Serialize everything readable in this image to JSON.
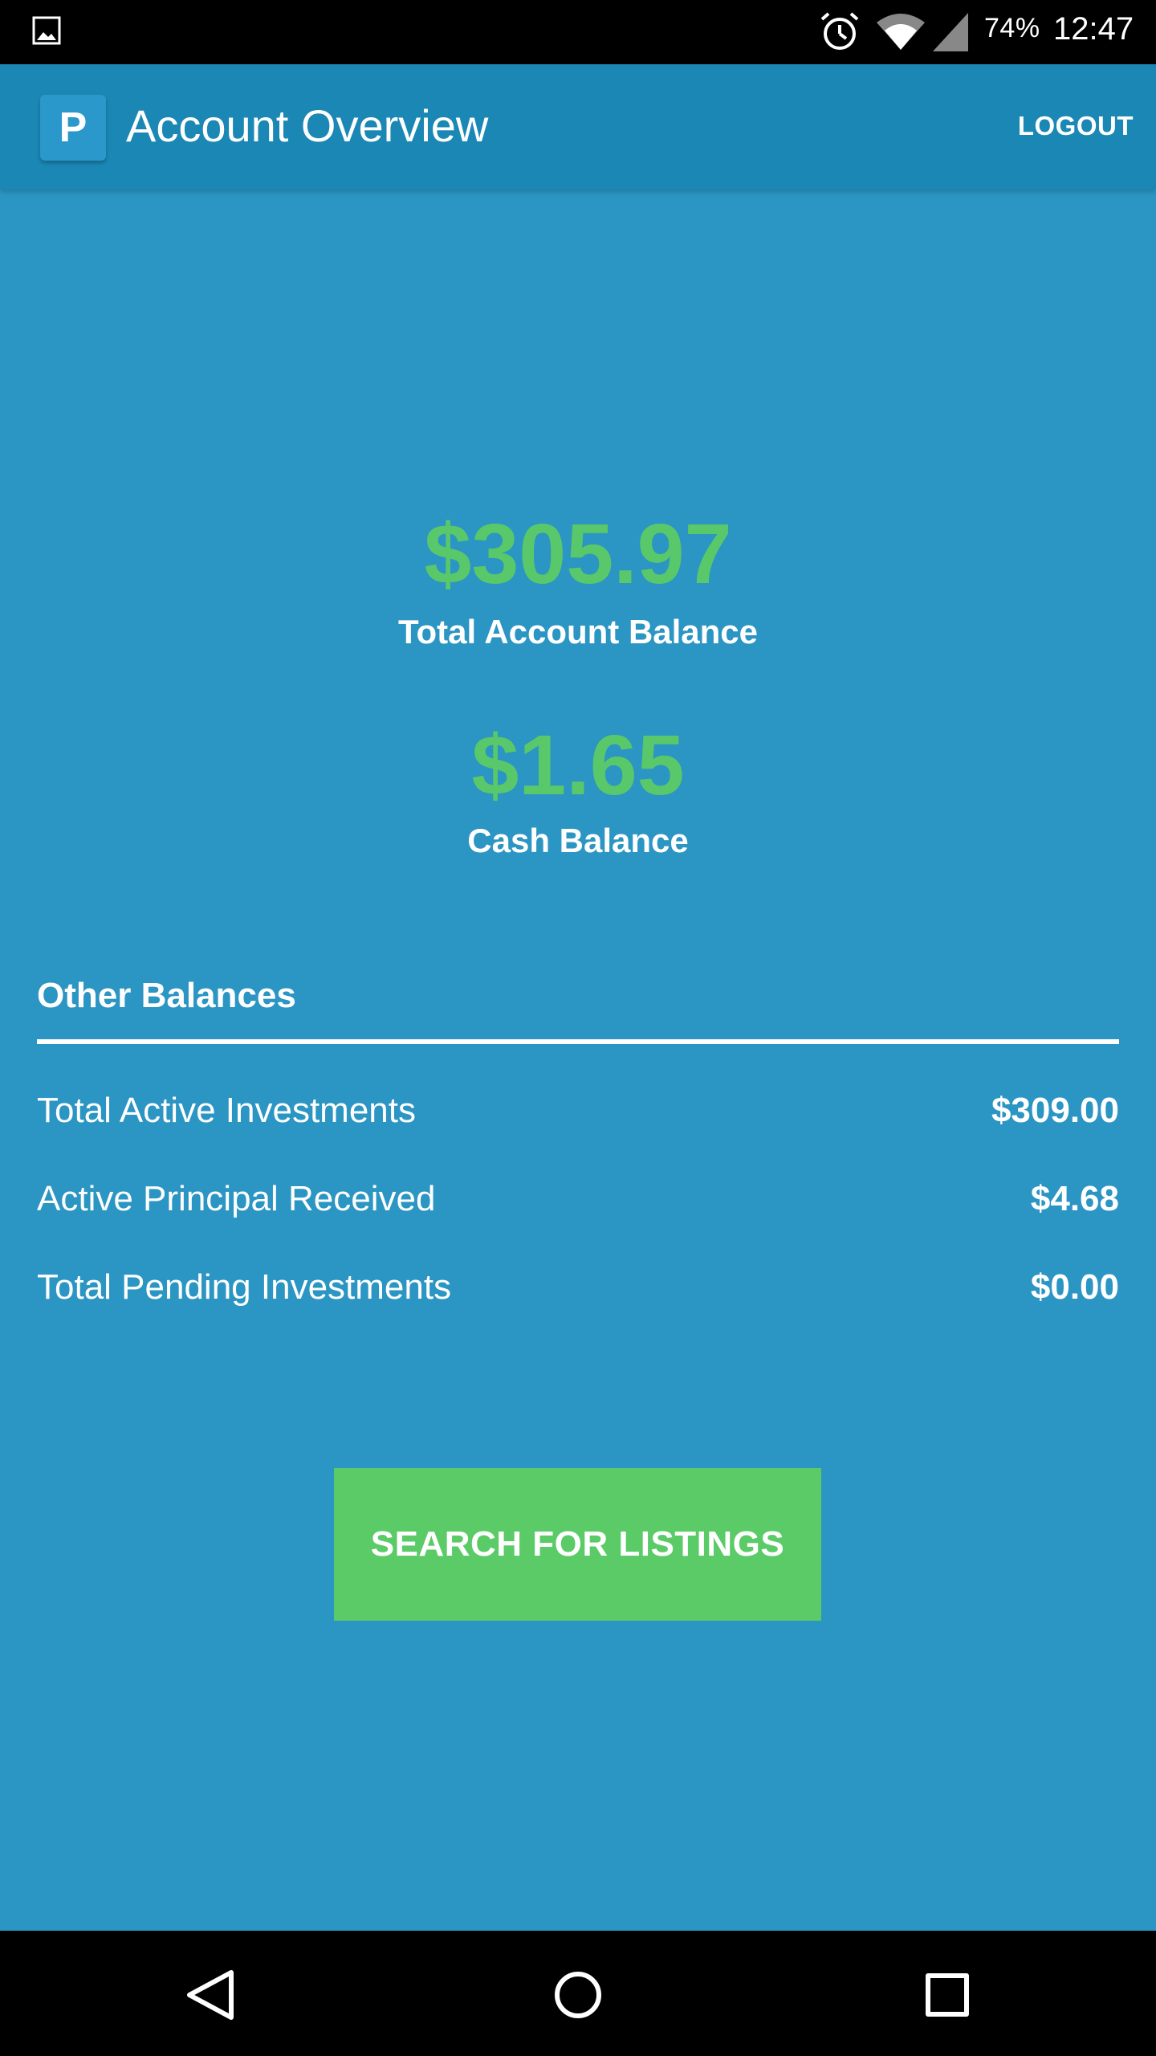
{
  "status_bar": {
    "battery": "74%",
    "time": "12:47",
    "icons": [
      "gallery-icon",
      "alarm-icon",
      "wifi-icon",
      "signal-icon"
    ]
  },
  "app_bar": {
    "logo_letter": "P",
    "title": "Account Overview",
    "logout_label": "LOGOUT"
  },
  "balances": {
    "total": {
      "amount": "$305.97",
      "label": "Total Account Balance"
    },
    "cash": {
      "amount": "$1.65",
      "label": "Cash Balance"
    }
  },
  "other_balances": {
    "heading": "Other Balances",
    "rows": [
      {
        "label": "Total Active Investments",
        "value": "$309.00"
      },
      {
        "label": "Active Principal Received",
        "value": "$4.68"
      },
      {
        "label": "Total Pending Investments",
        "value": "$0.00"
      }
    ]
  },
  "search_button_label": "SEARCH FOR LISTINGS",
  "colors": {
    "background": "#2b95c3",
    "app_bar": "#1b87b5",
    "accent_green": "#59c86a",
    "button_green": "#5bcb68"
  },
  "nav_bar": {
    "icons": [
      "back-icon",
      "home-icon",
      "recents-icon"
    ]
  }
}
